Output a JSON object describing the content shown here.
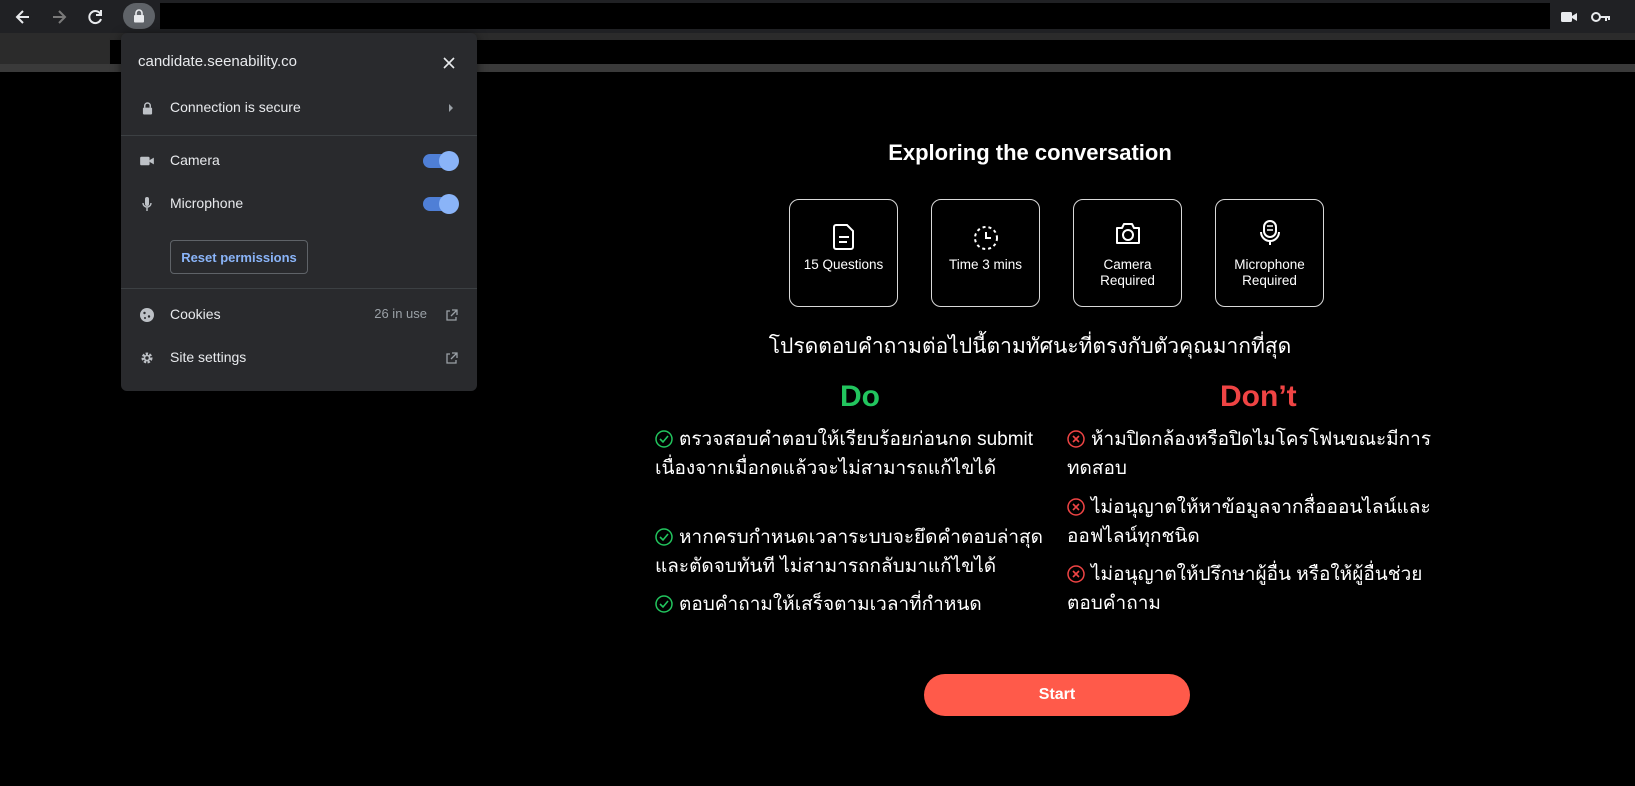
{
  "popup": {
    "site": "candidate.seenability.co",
    "connection_label": "Connection is secure",
    "camera_label": "Camera",
    "camera_enabled": true,
    "microphone_label": "Microphone",
    "microphone_enabled": true,
    "reset_label": "Reset permissions",
    "cookies_label": "Cookies",
    "cookies_count": "26 in use",
    "site_settings_label": "Site settings"
  },
  "page": {
    "title": "Exploring the conversation",
    "cards": [
      {
        "label": "15 Questions",
        "icon": "document-icon"
      },
      {
        "label": "Time 3 mins",
        "icon": "timer-icon"
      },
      {
        "label": "Camera Required",
        "icon": "camera-icon"
      },
      {
        "label": "Microphone Required",
        "icon": "microphone-icon"
      }
    ],
    "instruction": "โปรดตอบคำถามต่อไปนี้ตามทัศนะที่ตรงกับตัวคุณมากที่สุด",
    "do_heading": "Do",
    "dont_heading": "Don’t",
    "do_items": [
      "ตรวจสอบคำตอบให้เรียบร้อยก่อนกด submit เนื่องจากเมื่อกดแล้วจะไม่สามารถแก้ไขได้",
      "หากครบกำหนดเวลาระบบจะยึดคำตอบล่าสุด และตัดจบทันที ไม่สามารถกลับมาแก้ไขได้",
      "ตอบคำถามให้เสร็จตามเวลาที่กำหนด"
    ],
    "dont_items": [
      "ห้ามปิดกล้องหรือปิดไมโครโฟนขณะมีการทดสอบ",
      "ไม่อนุญาตให้หาข้อมูลจากสื่อออนไลน์และออฟไลน์ทุกชนิด",
      "ไม่อนุญาตให้ปรึกษาผู้อื่น หรือให้ผู้อื่นช่วยตอบคำถาม"
    ],
    "start_label": "Start"
  },
  "colors": {
    "do": "#22c55e",
    "dont": "#ef4444",
    "start": "#ff5a4a",
    "toggle": "#8ab4f8"
  }
}
